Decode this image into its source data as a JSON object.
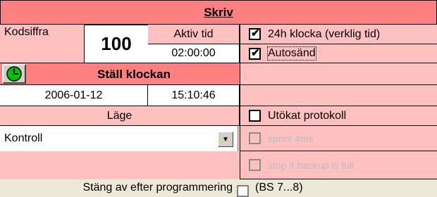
{
  "header": {
    "title": "Skriv"
  },
  "code": {
    "label": "Kodsiffra",
    "value": "100"
  },
  "active_time": {
    "label": "Aktiv tid",
    "value": "02:00:00"
  },
  "clock": {
    "set_label": "Ställ klockan",
    "date": "2006-01-12",
    "time": "15:10:46"
  },
  "mode": {
    "label": "Läge",
    "selected": "Kontroll"
  },
  "options": {
    "clock24": {
      "label": "24h klocka (verklig tid)",
      "checked": true
    },
    "autosend": {
      "label": "Autosänd",
      "checked": true
    },
    "extended": {
      "label": "Utökat protokoll",
      "checked": false
    },
    "sprint": {
      "label": "sprint 4ms",
      "checked": false
    },
    "stop_backup": {
      "label": "stop if backup is full",
      "checked": false
    }
  },
  "footer": {
    "label": "Stäng av efter programmering",
    "extra": "(BS 7...8)"
  },
  "colors": {
    "header_bg": "#ff8080",
    "panel_bg": "#ffc0c0",
    "window_bg": "#ece9d8"
  }
}
